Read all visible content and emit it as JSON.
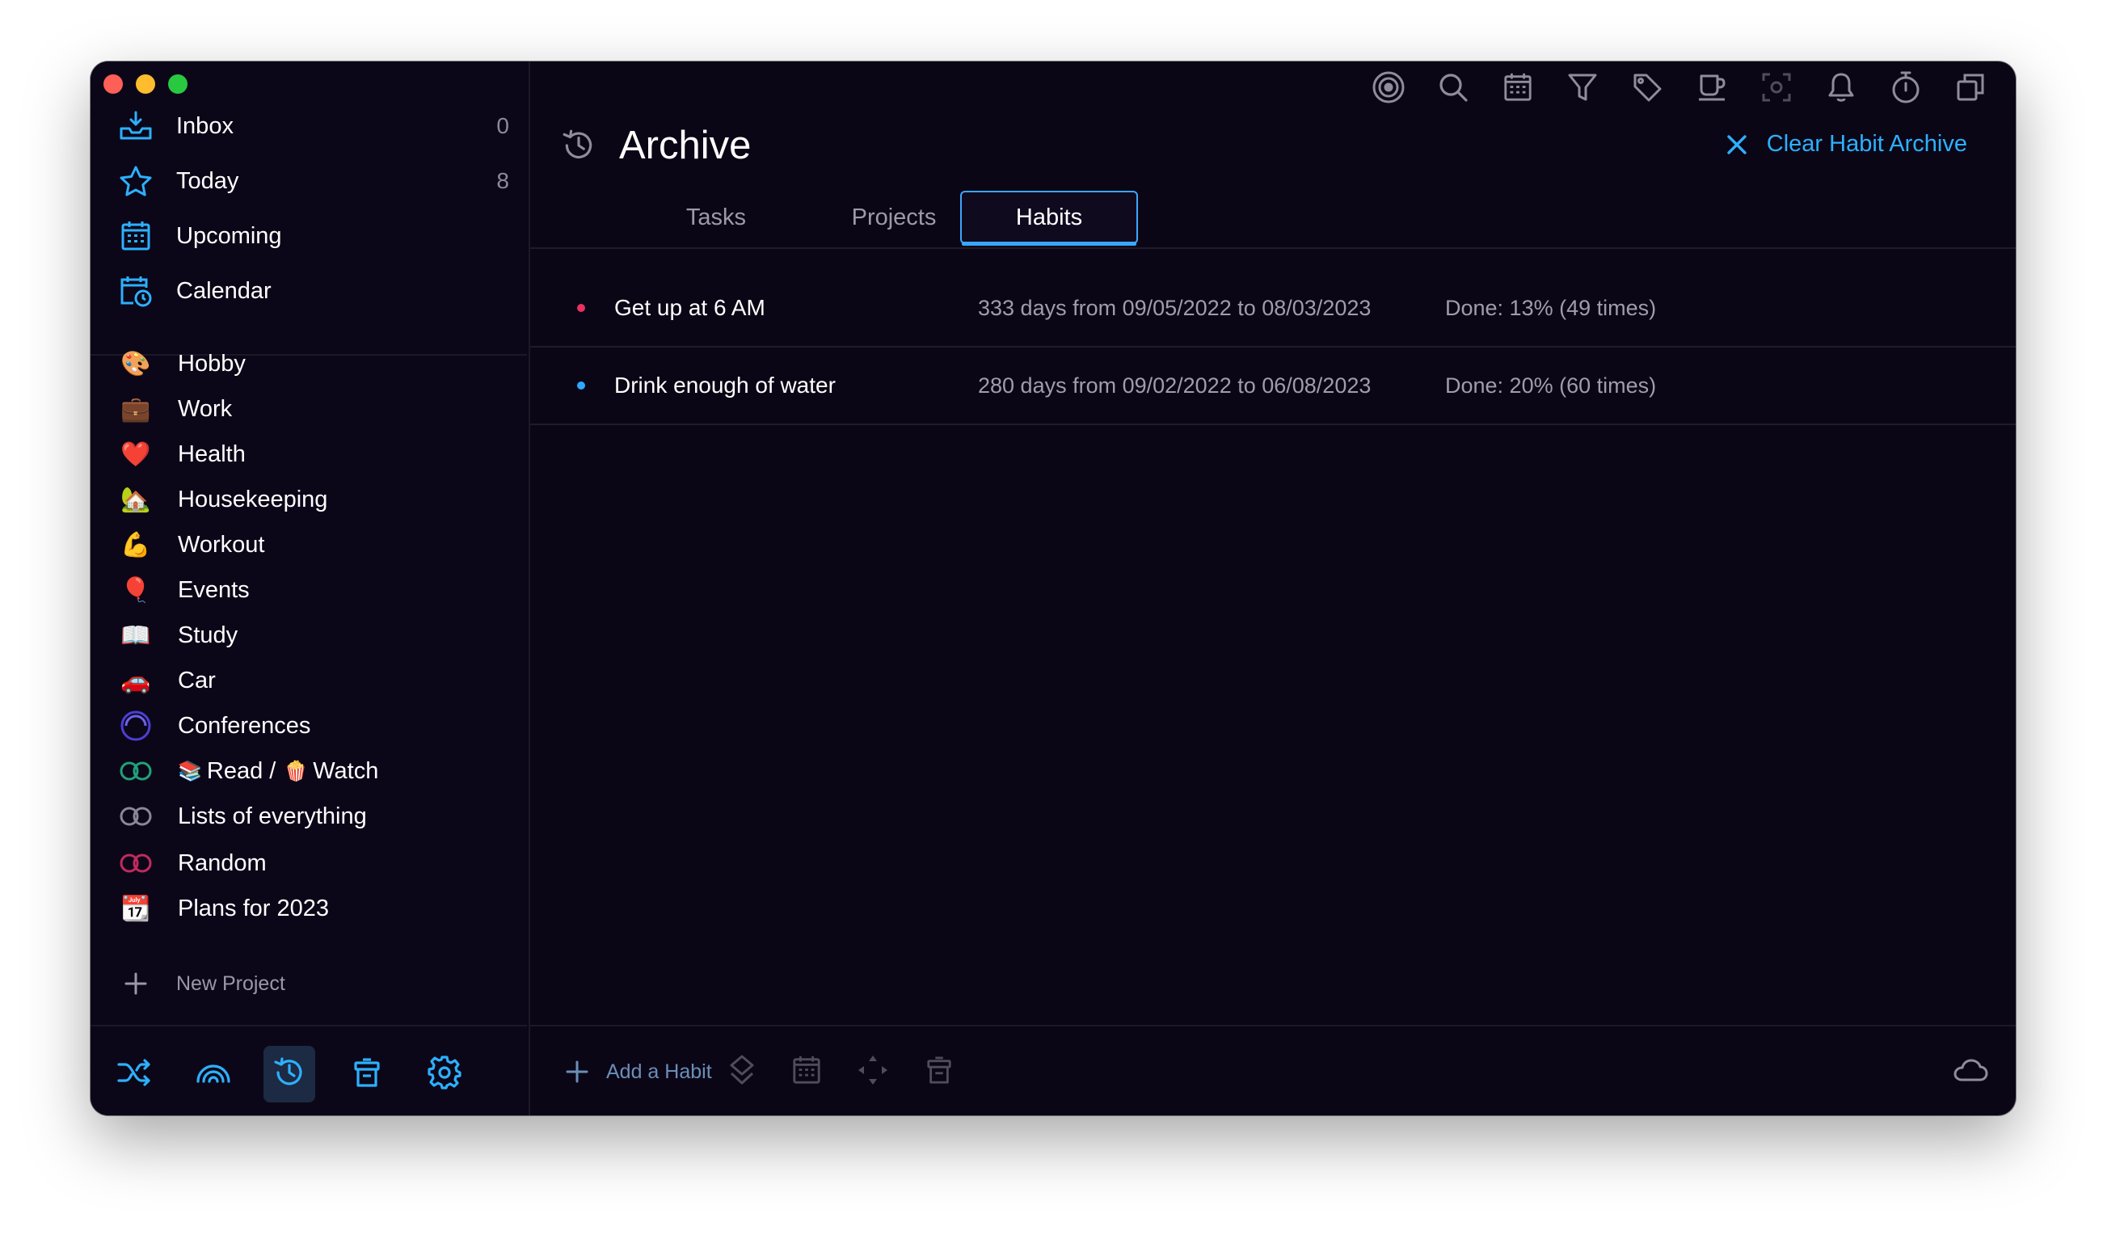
{
  "window": {
    "title": "Archive",
    "clear_label": "Clear Habit Archive"
  },
  "sidebar": {
    "nav": [
      {
        "label": "Inbox",
        "count": "0",
        "icon": "inbox-icon"
      },
      {
        "label": "Today",
        "count": "8",
        "icon": "star-icon"
      },
      {
        "label": "Upcoming",
        "count": "",
        "icon": "calendar-grid-icon"
      },
      {
        "label": "Calendar",
        "count": "",
        "icon": "calendar-clock-icon"
      }
    ],
    "projects": [
      {
        "label": "Hobby",
        "icon": "🎨"
      },
      {
        "label": "Work",
        "icon": "💼"
      },
      {
        "label": "Health",
        "icon": "❤️"
      },
      {
        "label": "Housekeeping",
        "icon": "🏡"
      },
      {
        "label": "Workout",
        "icon": "💪"
      },
      {
        "label": "Events",
        "icon": "🎈"
      },
      {
        "label": "Study",
        "icon": "📖"
      },
      {
        "label": "Car",
        "icon": "🚗"
      },
      {
        "label": "Conferences",
        "icon": "circle-ring-icon"
      },
      {
        "label_a": "Read /",
        "label_b": "Watch",
        "emoji_a": "📚",
        "emoji_b": "🍿",
        "icon": "linked-rings-green-icon"
      },
      {
        "label": "Lists of everything",
        "icon": "linked-rings-gray-icon"
      },
      {
        "label": "Random",
        "icon": "linked-rings-pink-icon"
      },
      {
        "label": "Plans for 2023",
        "icon": "📆"
      }
    ],
    "new_project_label": "New Project"
  },
  "tabs": [
    {
      "label": "Tasks",
      "active": false
    },
    {
      "label": "Projects",
      "active": false
    },
    {
      "label": "Habits",
      "active": true
    }
  ],
  "habits": [
    {
      "name": "Get up at 6 AM",
      "range": "333 days from 09/05/2022 to 08/03/2023",
      "done": "Done: 13% (49 times)",
      "color": "#e8325f"
    },
    {
      "name": "Drink enough of water",
      "range": "280 days from 09/02/2022 to 06/08/2023",
      "done": "Done: 20% (60 times)",
      "color": "#2da8ff"
    }
  ],
  "bottombar": {
    "add_label": "Add a Habit"
  },
  "colors": {
    "accent": "#2db0ff",
    "background": "#0b0616"
  }
}
